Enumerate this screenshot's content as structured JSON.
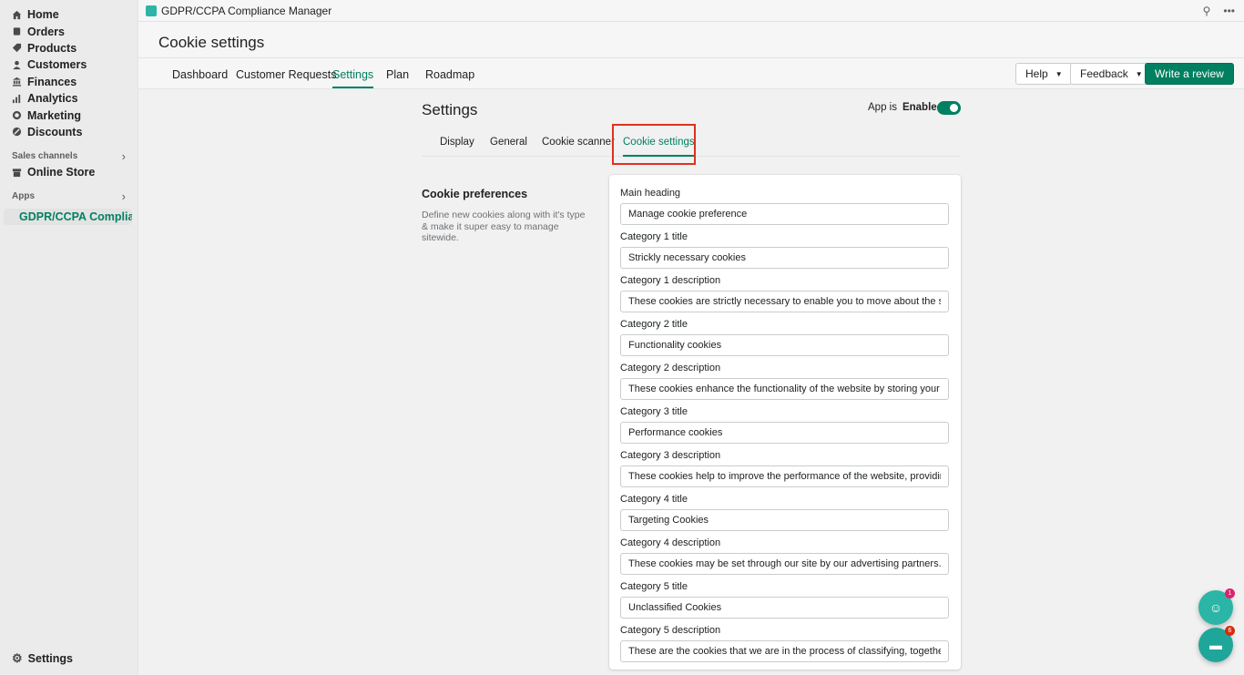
{
  "sidebar": {
    "items": [
      {
        "label": "Home",
        "icon": "home-icon"
      },
      {
        "label": "Orders",
        "icon": "orders-icon"
      },
      {
        "label": "Products",
        "icon": "tag-icon"
      },
      {
        "label": "Customers",
        "icon": "person-icon"
      },
      {
        "label": "Finances",
        "icon": "bank-icon"
      },
      {
        "label": "Analytics",
        "icon": "bar-chart-icon"
      },
      {
        "label": "Marketing",
        "icon": "target-icon"
      },
      {
        "label": "Discounts",
        "icon": "discount-icon"
      }
    ],
    "sales_channels_label": "Sales channels",
    "online_store_label": "Online Store",
    "apps_label": "Apps",
    "active_app_label": "GDPR/CCPA Complianc...",
    "settings_label": "Settings"
  },
  "topbar": {
    "app_title": "GDPR/CCPA Compliance Manager"
  },
  "page": {
    "title": "Cookie settings"
  },
  "main_tabs": [
    "Dashboard",
    "Customer Requests",
    "Settings",
    "Plan",
    "Roadmap"
  ],
  "main_tabs_active": "Settings",
  "header_buttons": {
    "help": "Help",
    "feedback": "Feedback",
    "write_review": "Write a review"
  },
  "settings": {
    "title": "Settings",
    "app_is_label": "App is",
    "app_status": "Enabled",
    "subtabs": [
      "Display",
      "General",
      "Cookie scanner",
      "Cookie settings"
    ],
    "active_subtab": "Cookie settings"
  },
  "cookie_preferences": {
    "title": "Cookie preferences",
    "description": "Define new cookies along with it's type & make it super easy to manage sitewide.",
    "fields": [
      {
        "label": "Main heading",
        "value": "Manage cookie preference"
      },
      {
        "label": "Category 1 title",
        "value": "Strickly necessary cookies"
      },
      {
        "label": "Category 1 description",
        "value": "These cookies are strictly necessary to enable you to move about the site or to provi"
      },
      {
        "label": "Category 2 title",
        "value": "Functionality cookies"
      },
      {
        "label": "Category 2 description",
        "value": "These cookies enhance the functionality of the website by storing your preferences"
      },
      {
        "label": "Category 3 title",
        "value": "Performance cookies"
      },
      {
        "label": "Category 3 description",
        "value": "These cookies help to improve the performance of the website, providing a better us"
      },
      {
        "label": "Category 4 title",
        "value": "Targeting Cookies"
      },
      {
        "label": "Category 4 description",
        "value": "These cookies may be set through our site by our advertising partners. They may be"
      },
      {
        "label": "Category 5 title",
        "value": "Unclassified Cookies"
      },
      {
        "label": "Category 5 description",
        "value": "These are the cookies that we are in the process of classifying, together with the pro"
      }
    ]
  },
  "floating": {
    "badge1": "1",
    "badge2": "6"
  }
}
